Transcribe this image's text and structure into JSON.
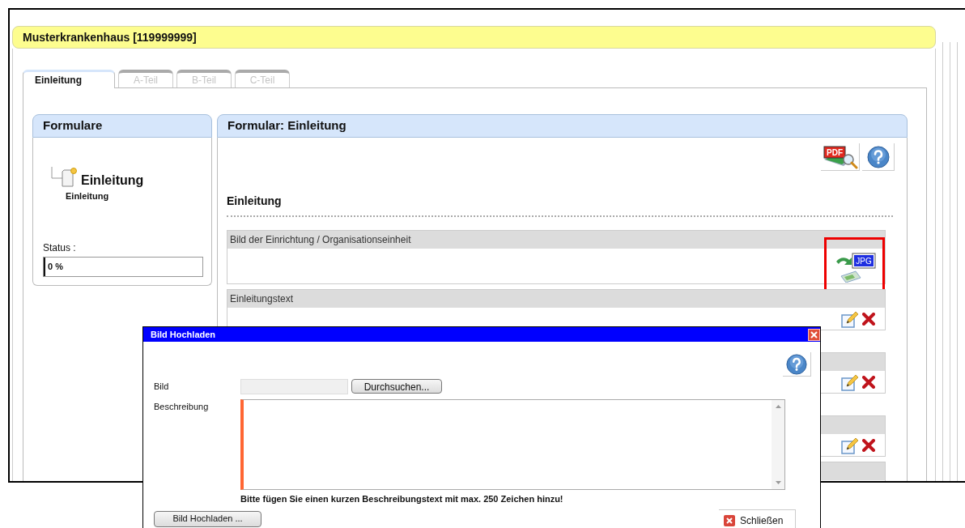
{
  "page_title": "Musterkrankenhaus [119999999]",
  "tabs": [
    {
      "label": "Einleitung",
      "selected": true
    },
    {
      "label": "A-Teil",
      "selected": false
    },
    {
      "label": "B-Teil",
      "selected": false
    },
    {
      "label": "C-Teil",
      "selected": false
    }
  ],
  "forms_panel": {
    "title": "Formulare",
    "tree_item": {
      "label": "Einleitung",
      "sublabel": "Einleitung"
    },
    "status": {
      "label": "Status :",
      "value": "0 %",
      "level": 0
    }
  },
  "form_panel": {
    "title": "Formular: Einleitung",
    "pdf_icon_label": "PDF",
    "section_heading": "Einleitung",
    "fields": [
      {
        "kind": "image",
        "title": "Bild der Einrichtung / Organisationseinheit",
        "icon_label": "JPG",
        "highlighted": true
      },
      {
        "kind": "text",
        "title": "Einleitungstext",
        "highlighted": false
      },
      {
        "kind": "text",
        "highlighted": false
      },
      {
        "kind": "text",
        "highlighted": false
      },
      {
        "kind": "text",
        "highlighted": false
      }
    ]
  },
  "dialog": {
    "title": "Bild Hochladen",
    "image_label": "Bild",
    "browse_button": "Durchsuchen...",
    "description_label": "Beschreibung",
    "hint": "Bitte fügen Sie einen kurzen Beschreibungstext mit max. 250 Zeichen hinzu!",
    "upload_button": "Bild Hochladen ...",
    "close_button": "Schließen"
  }
}
